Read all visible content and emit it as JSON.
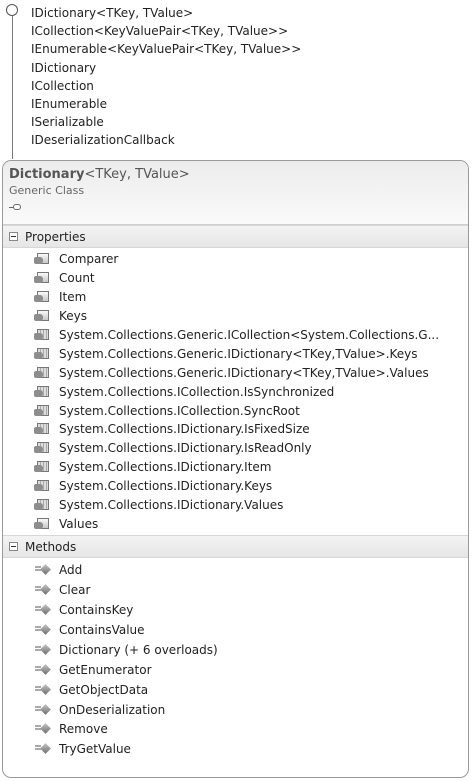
{
  "interfaces": [
    "IDictionary<TKey, TValue>",
    "ICollection<KeyValuePair<TKey, TValue>>",
    "IEnumerable<KeyValuePair<TKey, TValue>>",
    "IDictionary",
    "ICollection",
    "IEnumerable",
    "ISerializable",
    "IDeserializationCallback"
  ],
  "class": {
    "name": "Dictionary",
    "generic_params": "<TKey, TValue>",
    "kind": "Generic Class"
  },
  "properties": {
    "label": "Properties",
    "items": [
      {
        "name": "Comparer",
        "icon": "property-icon"
      },
      {
        "name": "Count",
        "icon": "property-icon"
      },
      {
        "name": "Item",
        "icon": "property-icon"
      },
      {
        "name": "Keys",
        "icon": "property-icon"
      },
      {
        "name": "System.Collections.Generic.ICollection<System.Collections.G...",
        "icon": "explicit-property-icon"
      },
      {
        "name": "System.Collections.Generic.IDictionary<TKey,TValue>.Keys",
        "icon": "explicit-property-icon"
      },
      {
        "name": "System.Collections.Generic.IDictionary<TKey,TValue>.Values",
        "icon": "explicit-property-icon"
      },
      {
        "name": "System.Collections.ICollection.IsSynchronized",
        "icon": "explicit-property-icon"
      },
      {
        "name": "System.Collections.ICollection.SyncRoot",
        "icon": "explicit-property-icon"
      },
      {
        "name": "System.Collections.IDictionary.IsFixedSize",
        "icon": "explicit-property-icon"
      },
      {
        "name": "System.Collections.IDictionary.IsReadOnly",
        "icon": "explicit-property-icon"
      },
      {
        "name": "System.Collections.IDictionary.Item",
        "icon": "explicit-property-icon"
      },
      {
        "name": "System.Collections.IDictionary.Keys",
        "icon": "explicit-property-icon"
      },
      {
        "name": "System.Collections.IDictionary.Values",
        "icon": "explicit-property-icon"
      },
      {
        "name": "Values",
        "icon": "property-icon"
      }
    ]
  },
  "methods": {
    "label": "Methods",
    "items": [
      {
        "name": "Add",
        "icon": "method-icon"
      },
      {
        "name": "Clear",
        "icon": "method-icon"
      },
      {
        "name": "ContainsKey",
        "icon": "method-icon"
      },
      {
        "name": "ContainsValue",
        "icon": "method-icon"
      },
      {
        "name": "Dictionary (+ 6 overloads)",
        "icon": "method-icon"
      },
      {
        "name": "GetEnumerator",
        "icon": "method-icon"
      },
      {
        "name": "GetObjectData",
        "icon": "method-icon"
      },
      {
        "name": "OnDeserialization",
        "icon": "method-icon"
      },
      {
        "name": "Remove",
        "icon": "method-icon"
      },
      {
        "name": "TryGetValue",
        "icon": "method-icon"
      }
    ]
  }
}
